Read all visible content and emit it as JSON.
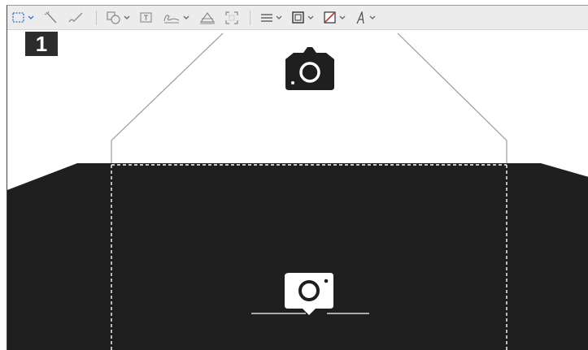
{
  "step_badge": "1",
  "toolbar": {
    "tools": [
      {
        "name": "rectangular-selection-icon",
        "dropdown": true,
        "active": true
      },
      {
        "name": "instant-alpha-icon",
        "dropdown": false
      },
      {
        "name": "sketch-icon",
        "dropdown": false
      },
      {
        "name": "shapes-icon",
        "dropdown": true
      },
      {
        "name": "text-icon",
        "dropdown": false
      },
      {
        "name": "sign-icon",
        "dropdown": true
      },
      {
        "name": "adjust-color-icon",
        "dropdown": false
      },
      {
        "name": "adjust-size-icon",
        "dropdown": false
      },
      {
        "name": "shape-style-icon",
        "dropdown": true
      },
      {
        "name": "border-color-icon",
        "dropdown": true
      },
      {
        "name": "fill-color-icon",
        "dropdown": true
      },
      {
        "name": "text-style-icon",
        "dropdown": true
      }
    ]
  },
  "canvas": {
    "top_camera_icon": "camera-icon",
    "bottom_camera_icon": "camera-icon"
  },
  "colors": {
    "accent": "#2f6fd0",
    "dark_region": "#1f1f1f",
    "fill_color_slash": "#d43030"
  }
}
